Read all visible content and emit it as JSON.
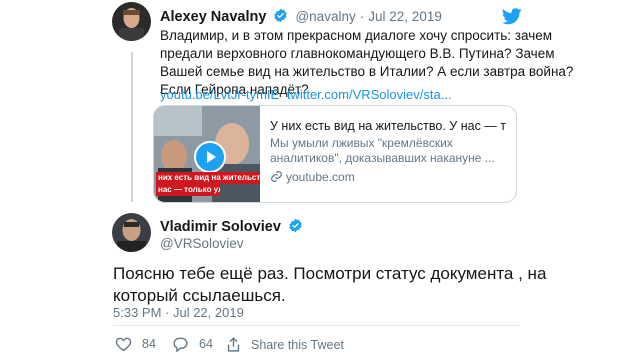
{
  "tweet1": {
    "author": "Alexey Navalny",
    "handle": "@navalny",
    "separator": "·",
    "date": "Jul 22, 2019",
    "lines": [
      "Владимир, и в этом прекрасном диалоге хочу спросить: зачем",
      "предали верховного главнокомандующего В.В. Путина? Зачем",
      "Вашей семье вид на жительство в Италии? А если завтра война?",
      "Если Гейропа нападёт?"
    ],
    "link1": "youtu.be/LvtJr-tymIE",
    "link2": "twitter.com/VRSoloviev/sta...",
    "card": {
      "title": "У них есть вид на жительство. У нас — тольк...",
      "desc_lines": [
        "Мы умыли лживых \"кремлёвских",
        "аналитиков\", доказывавших накануне ..."
      ],
      "domain": "youtube.com",
      "thumb_caption1": "них есть вид на жительств",
      "thumb_caption2": "нас — только улица"
    }
  },
  "tweet2": {
    "author": "Vladimir Soloviev",
    "handle": "@VRSoloviev",
    "lines": [
      "Поясню тебе ещё раз.  Посмотри статус документа , на",
      "который ссылаешься."
    ],
    "timestamp": "5:33 PM · Jul 22, 2019",
    "likes": "84",
    "replies": "64",
    "share_label": "Share this Tweet"
  },
  "colors": {
    "twitter_blue": "#1da1f2",
    "link": "#1b95e0",
    "muted": "#657786",
    "border": "#ccd6dd",
    "text": "#14171a"
  },
  "icons": {
    "brand": "twitter-bird-icon",
    "verified": "verified-badge-icon",
    "like": "heart-icon",
    "reply": "reply-bubble-icon",
    "share": "share-icon"
  }
}
